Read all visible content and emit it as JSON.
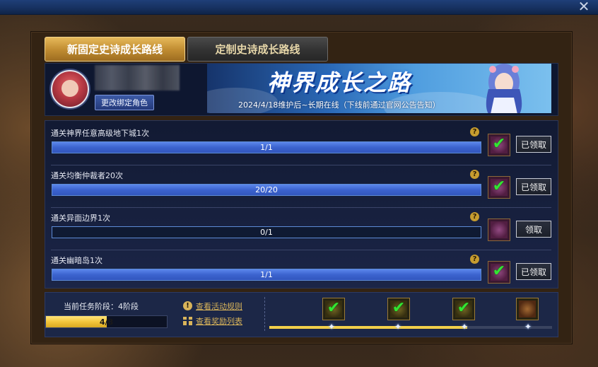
{
  "window": {
    "close_glyph": "✕"
  },
  "tabs": [
    {
      "label": "新固定史诗成长路线",
      "active": true
    },
    {
      "label": "定制史诗成长路线",
      "active": false
    }
  ],
  "header": {
    "bind_button": "更改绑定角色",
    "banner_title": "神界成长之路",
    "banner_subtitle": "2024/4/18维护后~长期在线（下线前通过官网公告告知）"
  },
  "tasks": [
    {
      "label": "通关神界任意高级地下城1次",
      "progress_text": "1/1",
      "progress": 1.0,
      "claimed": true,
      "button": "已领取"
    },
    {
      "label": "通关均衡仲裁者20次",
      "progress_text": "20/20",
      "progress": 1.0,
      "claimed": true,
      "button": "已领取"
    },
    {
      "label": "通关异面边界1次",
      "progress_text": "0/1",
      "progress": 0.0,
      "claimed": false,
      "button": "领取"
    },
    {
      "label": "通关幽暗岛1次",
      "progress_text": "1/1",
      "progress": 1.0,
      "claimed": true,
      "button": "已领取"
    }
  ],
  "footer": {
    "stage_label": "当前任务阶段：4阶段",
    "stage_progress_text": "4/8",
    "stage_progress": 0.5,
    "rules_link": "查看活动规则",
    "rewards_link": "查看奖励列表",
    "track_progress": 0.7,
    "stage_rewards": [
      {
        "claimed": true
      },
      {
        "claimed": true
      },
      {
        "claimed": true
      },
      {
        "claimed": false
      }
    ]
  },
  "icons": {
    "help": "?",
    "check": "✔",
    "star": "✦",
    "info": "!"
  },
  "colors": {
    "accent_gold": "#c28e33",
    "bar_blue": "#3c63cf",
    "stage_yellow": "#f3c63c",
    "check_green": "#32e632"
  }
}
